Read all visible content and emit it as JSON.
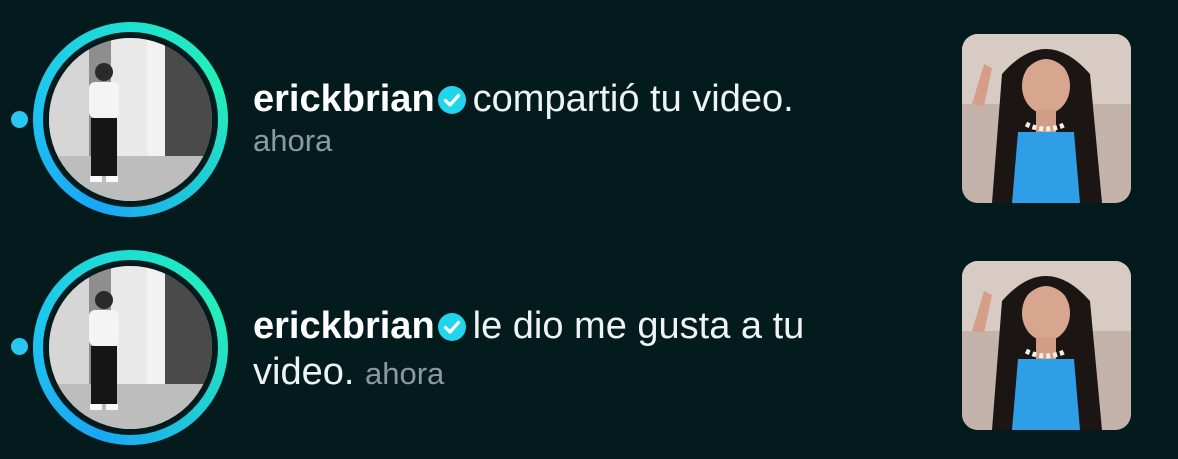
{
  "notifications": [
    {
      "username": "erickbrian",
      "action": "compartió tu video.",
      "time": "ahora",
      "verified": true,
      "unread": true
    },
    {
      "username": "erickbrian",
      "action": "le dio me gusta a tu",
      "action_cont": "video.",
      "time": "ahora",
      "verified": true,
      "unread": true
    }
  ],
  "colors": {
    "background": "#041b1e",
    "unread_dot": "#29c7f0",
    "verified_badge": "#20d5ec",
    "ring_start": "#1aa7f6",
    "ring_end": "#25eeb8",
    "secondary_text": "#8d9a9c"
  },
  "icons": {
    "verified": "verified-check-icon"
  }
}
